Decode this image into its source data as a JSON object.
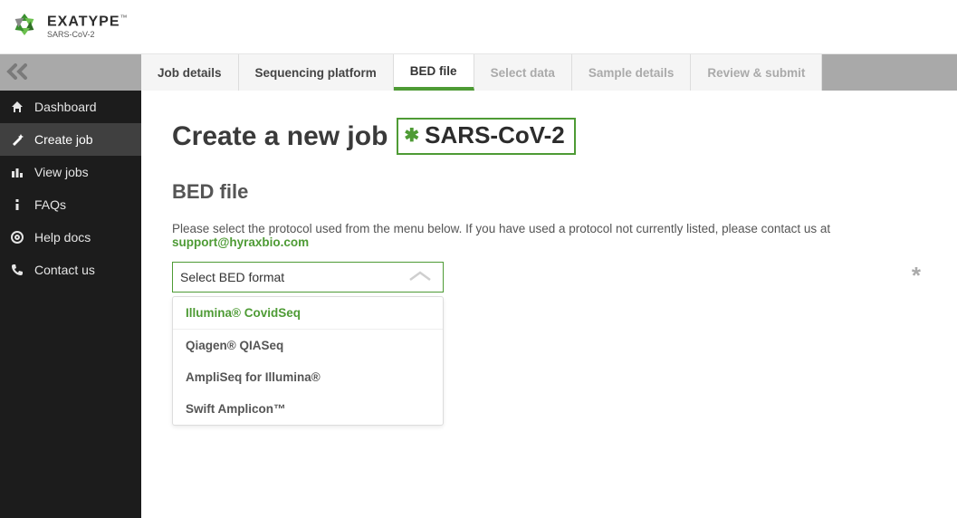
{
  "brand": {
    "name": "EXATYPE",
    "subtitle": "SARS-CoV-2",
    "tm": "™"
  },
  "sidebar": {
    "items": [
      {
        "label": "Dashboard",
        "icon": "home"
      },
      {
        "label": "Create job",
        "icon": "wand"
      },
      {
        "label": "View jobs",
        "icon": "bars"
      },
      {
        "label": "FAQs",
        "icon": "info"
      },
      {
        "label": "Help docs",
        "icon": "life-ring"
      },
      {
        "label": "Contact us",
        "icon": "phone"
      }
    ]
  },
  "tabs": [
    {
      "label": "Job details",
      "state": "normal"
    },
    {
      "label": "Sequencing platform",
      "state": "normal"
    },
    {
      "label": "BED file",
      "state": "active"
    },
    {
      "label": "Select data",
      "state": "disabled"
    },
    {
      "label": "Sample details",
      "state": "disabled"
    },
    {
      "label": "Review & submit",
      "state": "disabled"
    }
  ],
  "page": {
    "heading": "Create a new job",
    "badge": "SARS-CoV-2",
    "section_title": "BED file",
    "description_prefix": "Please select the protocol used from the menu below. If you have used a protocol not currently listed, please contact us at ",
    "support_email": "support@hyraxbio.com",
    "select_placeholder": "Select BED format",
    "required_mark": "*",
    "options": [
      "Illumina® CovidSeq",
      "Qiagen® QIASeq",
      "AmpliSeq for Illumina®",
      "Swift Amplicon™"
    ]
  }
}
